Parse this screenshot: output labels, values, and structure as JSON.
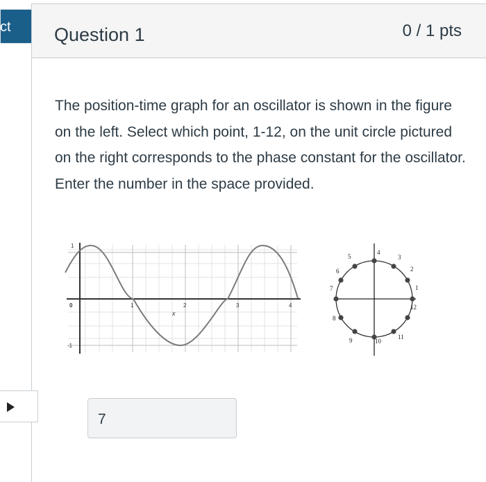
{
  "sidebar": {
    "tab_fragment": "ct"
  },
  "question": {
    "title": "Question 1",
    "points": "0 / 1 pts",
    "text": "The position-time graph for an oscillator is shown in the figure on the left. Select which point, 1-12, on the unit circle pictured on the right corresponds to the phase constant for the oscillator. Enter the number in the space provided."
  },
  "graph": {
    "y_ticks": [
      "1",
      "0",
      "-1"
    ],
    "x_ticks": [
      "1",
      "2",
      "3",
      "4"
    ],
    "x_label": "x"
  },
  "circle": {
    "point_labels": [
      "1",
      "2",
      "3",
      "4",
      "5",
      "6",
      "7",
      "8",
      "9",
      "10",
      "11",
      "12"
    ]
  },
  "answer": {
    "value": "7"
  },
  "colors": {
    "badge": "#1a5e8a",
    "text": "#2d3b45",
    "border": "#c7cdd1"
  }
}
